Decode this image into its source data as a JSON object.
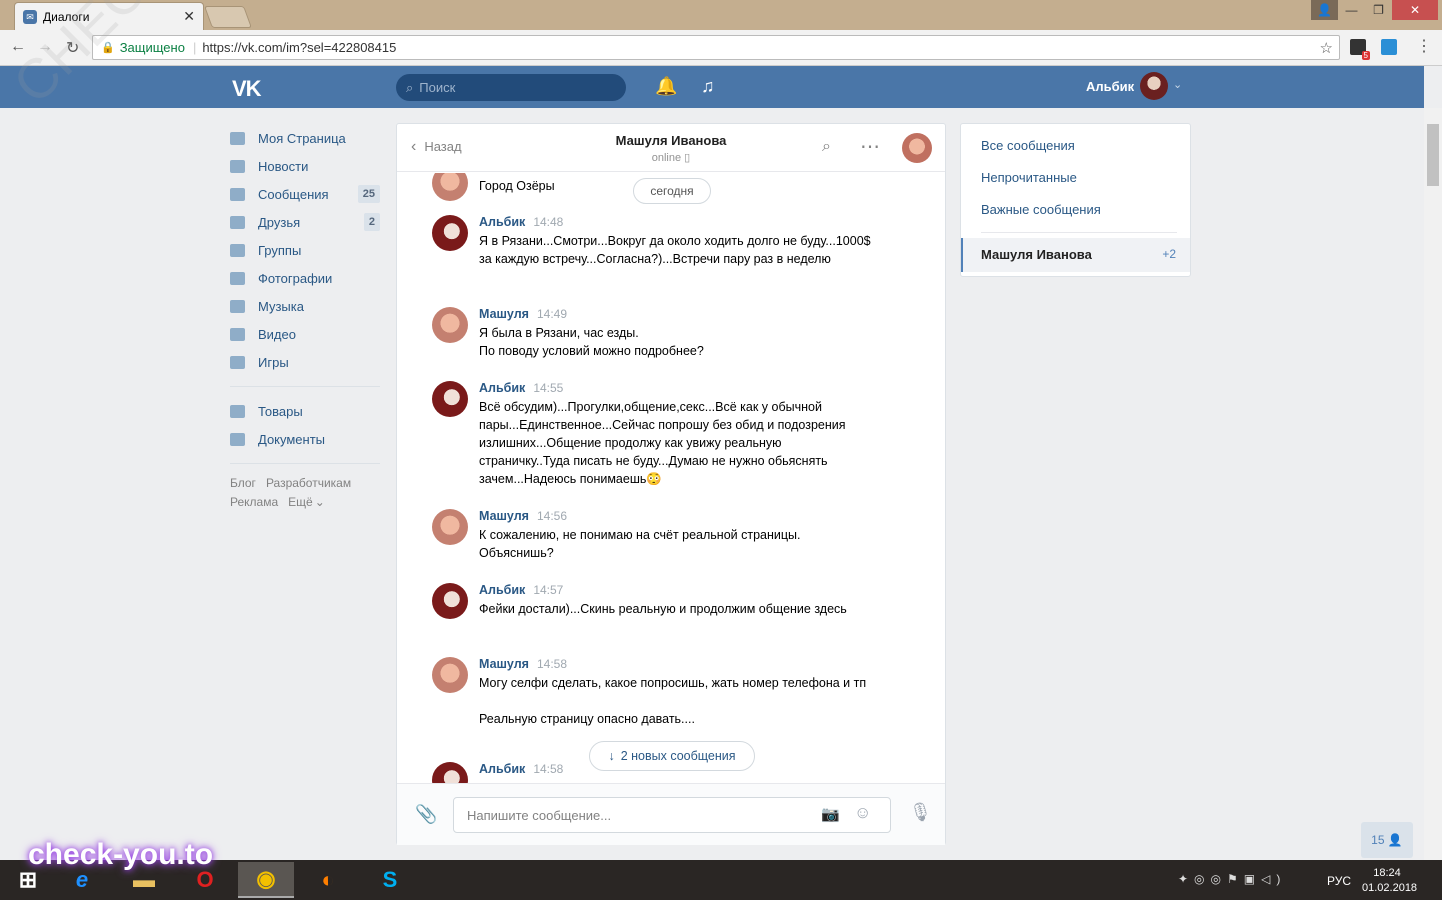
{
  "browser": {
    "tab_title": "Диалоги",
    "secure_label": "Защищено",
    "url": "https://vk.com/im?sel=422808415",
    "ext_badge": "5"
  },
  "vk_header": {
    "logo": "VK",
    "search_placeholder": "Поиск",
    "user_name": "Альбик"
  },
  "left_menu": {
    "items": [
      {
        "label": "Моя Страница",
        "icon": "home-icon"
      },
      {
        "label": "Новости",
        "icon": "news-icon"
      },
      {
        "label": "Сообщения",
        "icon": "chat-icon",
        "count": "25"
      },
      {
        "label": "Друзья",
        "icon": "person-icon",
        "count": "2"
      },
      {
        "label": "Группы",
        "icon": "group-icon"
      },
      {
        "label": "Фотографии",
        "icon": "camera-icon"
      },
      {
        "label": "Музыка",
        "icon": "music-icon"
      },
      {
        "label": "Видео",
        "icon": "film-icon"
      },
      {
        "label": "Игры",
        "icon": "gamepad-icon"
      }
    ],
    "items2": [
      {
        "label": "Товары",
        "icon": "bag-icon"
      },
      {
        "label": "Документы",
        "icon": "document-icon"
      }
    ],
    "footer": [
      "Блог",
      "Разработчикам",
      "Реклама",
      "Ещё"
    ]
  },
  "chat": {
    "back_label": "Назад",
    "title": "Машуля Иванова",
    "status": "online",
    "today_label": "сегодня",
    "new_messages_label": "2 новых сообщения",
    "composer_placeholder": "Напишите сообщение...",
    "messages": [
      {
        "author": "",
        "time": "",
        "text": "Город Озёры"
      },
      {
        "author": "Альбик",
        "time": "14:48",
        "text": "Я в Рязани...Смотри...Вокруг да около ходить долго не буду...1000$ за каждую встречу...Согласна?)...Встречи пару раз в неделю"
      },
      {
        "author": "Машуля",
        "time": "14:49",
        "text": "Я была в Рязани, час езды.\nПо поводу условий можно подробнее?"
      },
      {
        "author": "Альбик",
        "time": "14:55",
        "text": "Всё обсудим)...Прогулки,общение,секс...Всё как у обычной пары...Единственное...Сейчас попрошу без обид и подозрения излишних...Общение продолжу как увижу реальную страничку..Туда писать не буду...Думаю не нужно обьяснять зачем...Надеюсь понимаешь😳"
      },
      {
        "author": "Машуля",
        "time": "14:56",
        "text": "К сожалению, не понимаю на счёт реальной страницы. Объяснишь?"
      },
      {
        "author": "Альбик",
        "time": "14:57",
        "text": "Фейки достали)...Скинь реальную и продолжим общение здесь"
      },
      {
        "author": "Машуля",
        "time": "14:58",
        "text": "Могу селфи сделать, какое попросишь, жать номер телефона и тп\n\nРеальную страницу опасно давать...."
      },
      {
        "author": "Альбик",
        "time": "14:58",
        "text": ""
      }
    ]
  },
  "right_panel": {
    "all": "Все сообщения",
    "unread": "Непрочитанные",
    "important": "Важные сообщения",
    "active_name": "Машуля Иванова",
    "active_count": "+2"
  },
  "online_counter": "15",
  "taskbar": {
    "lang": "РУС",
    "time": "18:24",
    "date": "01.02.2018"
  },
  "watermark": {
    "bottom": "check-you.to",
    "diagonal": "CHECK-YOU.ME"
  }
}
